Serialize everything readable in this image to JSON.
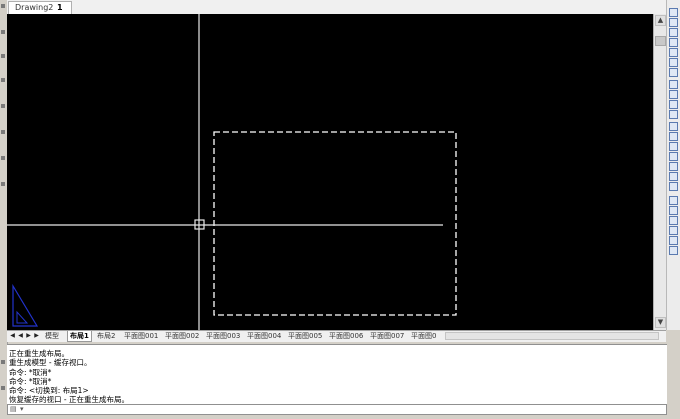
{
  "document_tab": {
    "name": "Drawing2",
    "number": "1"
  },
  "layout_tabs": {
    "items": [
      "模型",
      "布局1",
      "布局2",
      "平面图001",
      "平面图002",
      "平面图003",
      "平面图004",
      "平面图005",
      "平面图006",
      "平面图007",
      "平面图0"
    ],
    "active": "布局1"
  },
  "command_history": [
    "正在重生成布局。",
    "重生成模型 - 缓存视口。",
    "命令: *取消*",
    "命令: *取消*",
    "命令:  <切换到: 布局1>",
    "恢复缓存的视口 - 正在重生成布局。"
  ],
  "command_line": {
    "icon": "command-line-icon",
    "prompt": "▾",
    "value": ""
  },
  "colors": {
    "canvas": "#000000",
    "crosshair": "#ffffff",
    "viewport_border": "#ffffff",
    "ucs_icon": "#2233cc"
  },
  "icons": [
    "close-icon",
    "scroll-up-icon",
    "scroll-down-icon",
    "nav-first-icon",
    "nav-prev-icon",
    "nav-next-icon",
    "nav-last-icon",
    "ucs-icon",
    "toolbar-icons"
  ]
}
